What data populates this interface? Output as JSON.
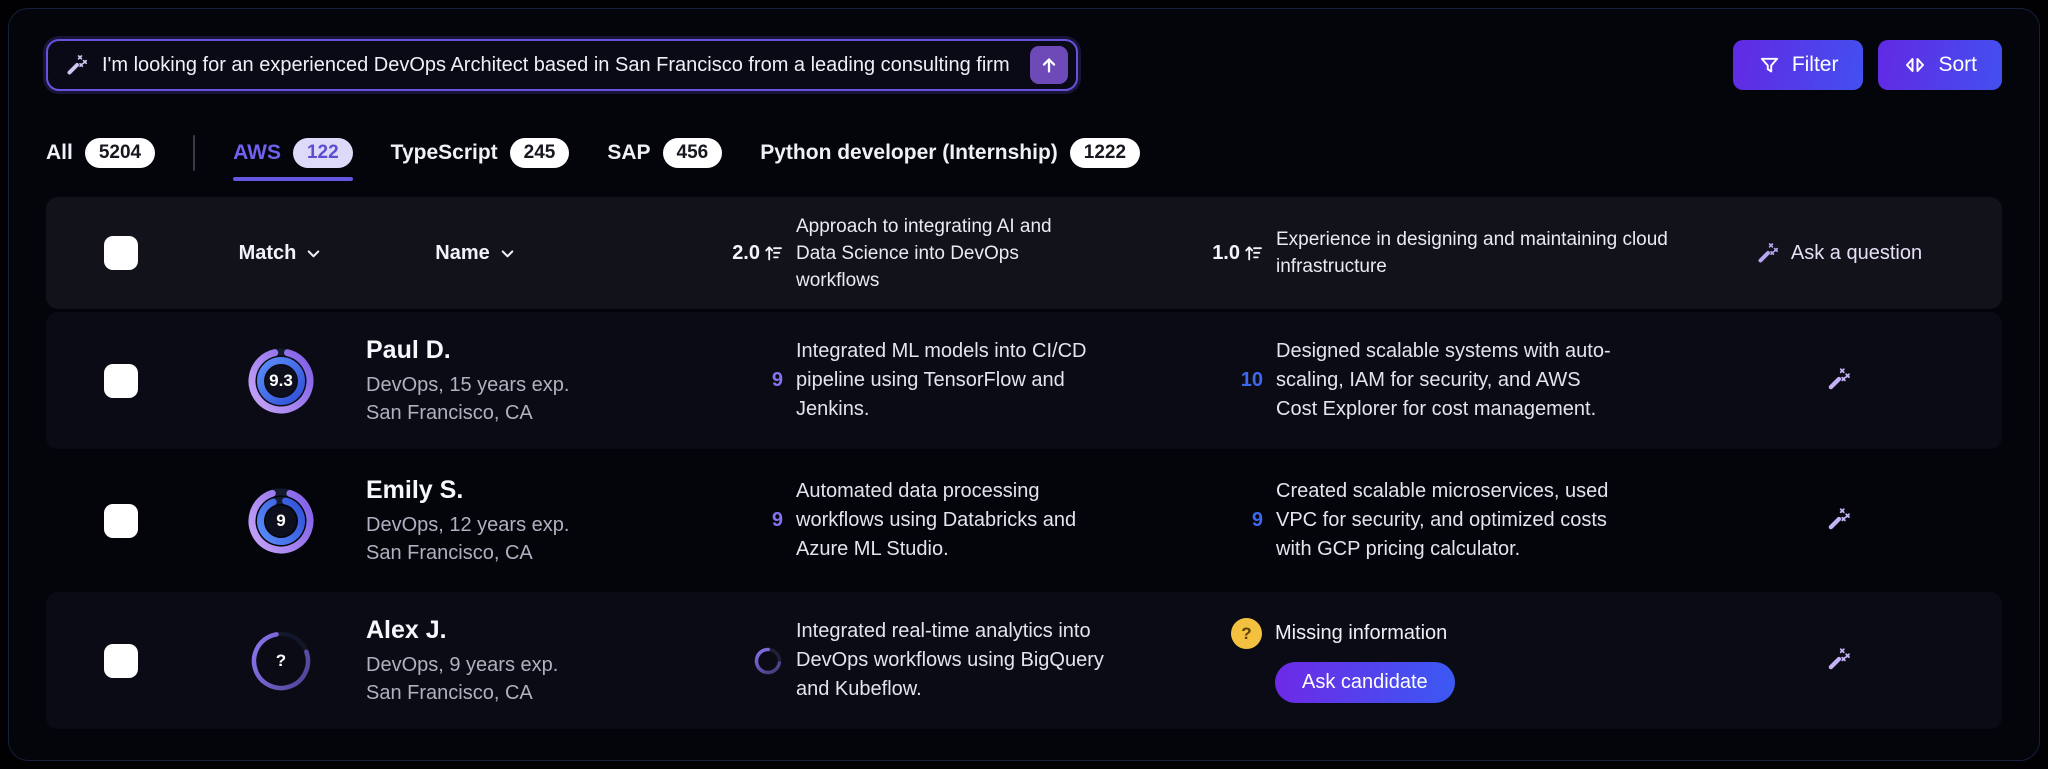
{
  "search": {
    "query": "I'm looking for an experienced DevOps Architect based in San Francisco from a leading consulting firm"
  },
  "toolbar": {
    "filter_label": "Filter",
    "sort_label": "Sort"
  },
  "tabs": [
    {
      "label": "All",
      "count": "5204"
    },
    {
      "label": "AWS",
      "count": "122",
      "active": true
    },
    {
      "label": "TypeScript",
      "count": "245"
    },
    {
      "label": "SAP",
      "count": "456"
    },
    {
      "label": "Python developer (Internship)",
      "count": "1222"
    }
  ],
  "table": {
    "header": {
      "match": "Match",
      "name": "Name",
      "col1_weight": "2.0",
      "col1_question": "Approach to integrating AI and Data Science into DevOps workflows",
      "col2_weight": "1.0",
      "col2_question": "Experience in designing and maintaining cloud infrastructure",
      "ask": "Ask a question"
    },
    "rows": [
      {
        "name": "Paul D.",
        "summary": "DevOps, 15 years exp.",
        "location": "San Francisco, CA",
        "match_score": "9.3",
        "col1_score": "9",
        "col1_text": "Integrated ML models into CI/CD pipeline using TensorFlow and Jenkins.",
        "col2_score": "10",
        "col2_text": "Designed scalable systems with auto-scaling, IAM for security, and AWS Cost Explorer for cost management."
      },
      {
        "name": "Emily S.",
        "summary": "DevOps, 12 years exp.",
        "location": "San Francisco, CA",
        "match_score": "9",
        "col1_score": "9",
        "col1_text": "Automated data processing workflows using Databricks and Azure ML Studio.",
        "col2_score": "9",
        "col2_text": "Created scalable microservices, used VPC for security, and optimized costs with GCP pricing calculator."
      },
      {
        "name": "Alex J.",
        "summary": "DevOps, 9 years exp.",
        "location": "San Francisco, CA",
        "match_score": "?",
        "col1_text": "Integrated real-time analytics into DevOps workflows using BigQuery and Kubeflow.",
        "col2_status": "Missing information",
        "col2_action": "Ask candidate"
      }
    ]
  },
  "colors": {
    "accent_purple": "#6553dd",
    "button_gradient_start": "#6229e3",
    "button_gradient_end": "#4350ef",
    "score_purple": "#8273f0",
    "score_blue": "#3e68f0",
    "ring_purple": "#9b7bf0",
    "ring_blue": "#3f74f0",
    "warning_yellow": "#f3c03f"
  }
}
